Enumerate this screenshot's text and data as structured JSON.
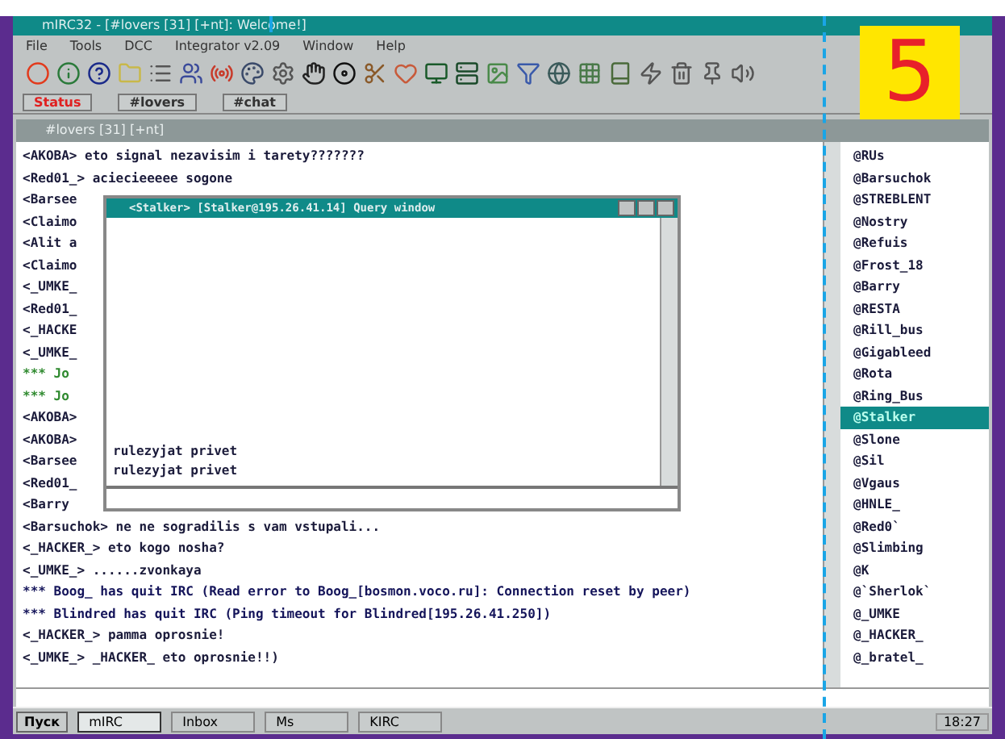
{
  "badge": "5",
  "window": {
    "title": "mIRC32 - [#lovers [31] [+nt]: Welcome!]"
  },
  "menu": [
    "File",
    "Tools",
    "DCC",
    "Integrator v2.09",
    "Window",
    "Help"
  ],
  "switchbar": [
    {
      "label": "Status",
      "highlight": true
    },
    {
      "label": "#lovers",
      "highlight": false
    },
    {
      "label": "#chat",
      "highlight": false
    }
  ],
  "channel_window": {
    "title": "#lovers [31] [+nt]",
    "lines": [
      {
        "kind": "message",
        "text": "<AKOBA> eto signal nezavisim i tarety???????"
      },
      {
        "kind": "message",
        "text": "<Red01_> aciecieeeee  sogone"
      },
      {
        "kind": "message",
        "text": "<Barsee"
      },
      {
        "kind": "message",
        "text": "<Claimo"
      },
      {
        "kind": "message",
        "text": "<Alit a"
      },
      {
        "kind": "message",
        "text": "<Claimo"
      },
      {
        "kind": "message",
        "text": "<_UMKE_"
      },
      {
        "kind": "message",
        "text": "<Red01_"
      },
      {
        "kind": "message",
        "text": "<_HACKE"
      },
      {
        "kind": "message",
        "text": "<_UMKE_"
      },
      {
        "kind": "join",
        "text": "*** Jo"
      },
      {
        "kind": "join",
        "text": "*** Jo"
      },
      {
        "kind": "message",
        "text": "<AKOBA>"
      },
      {
        "kind": "message",
        "text": "<AKOBA>"
      },
      {
        "kind": "message",
        "text": "<Barsee"
      },
      {
        "kind": "message",
        "text": "<Red01_"
      },
      {
        "kind": "message",
        "text": "<Barry"
      },
      {
        "kind": "message",
        "text": "<Barsuchok> ne ne sogradilis s vam vstupali..."
      },
      {
        "kind": "message",
        "text": "<_HACKER_> eto kogo nosha?"
      },
      {
        "kind": "message",
        "text": "<_UMKE_> ......zvonkaya"
      },
      {
        "kind": "quit",
        "text": "*** Boog_ has quit IRC (Read error to Boog_[bosmon.voco.ru]: Connection reset by peer)"
      },
      {
        "kind": "quit",
        "text": "*** Blindred has quit IRC (Ping timeout for Blindred[195.26.41.250])"
      },
      {
        "kind": "message",
        "text": "<_HACKER_> pamma oprosnie!"
      },
      {
        "kind": "message",
        "text": "<_UMKE_> _HACKER_ eto oprosnie!!)"
      }
    ],
    "nicks": [
      {
        "name": "@RUs",
        "selected": false
      },
      {
        "name": "@Barsuchok",
        "selected": false
      },
      {
        "name": "@STREBLENT",
        "selected": false
      },
      {
        "name": "@Nostry",
        "selected": false
      },
      {
        "name": "@Refuis",
        "selected": false
      },
      {
        "name": "@Frost_18",
        "selected": false
      },
      {
        "name": "@Barry",
        "selected": false
      },
      {
        "name": "@RESTA",
        "selected": false
      },
      {
        "name": "@Rill_bus",
        "selected": false
      },
      {
        "name": "@Gigableed",
        "selected": false
      },
      {
        "name": "@Rota",
        "selected": false
      },
      {
        "name": "@Ring_Bus",
        "selected": false
      },
      {
        "name": "@Stalker",
        "selected": true
      },
      {
        "name": "@Slone",
        "selected": false
      },
      {
        "name": "@Sil",
        "selected": false
      },
      {
        "name": "@Vgaus",
        "selected": false
      },
      {
        "name": "@HNLE_",
        "selected": false
      },
      {
        "name": "@Red0`",
        "selected": false
      },
      {
        "name": "@Slimbing",
        "selected": false
      },
      {
        "name": "@K",
        "selected": false
      },
      {
        "name": "@`Sherlok`",
        "selected": false
      },
      {
        "name": "@_UMKE",
        "selected": false
      },
      {
        "name": "@_HACKER_",
        "selected": false
      },
      {
        "name": "@_bratel_",
        "selected": false
      }
    ]
  },
  "query_window": {
    "title": "<Stalker> [Stalker@195.26.41.14] Query window",
    "lines": [
      "rulezyjat privet",
      "rulezyjat privet"
    ]
  },
  "taskbar": {
    "start": "Пуск",
    "buttons": [
      {
        "label": "mIRC",
        "selected": true
      },
      {
        "label": "Inbox",
        "selected": false
      },
      {
        "label": "Ms",
        "selected": false
      },
      {
        "label": "KIRC",
        "selected": false
      }
    ],
    "clock": "18:27"
  }
}
